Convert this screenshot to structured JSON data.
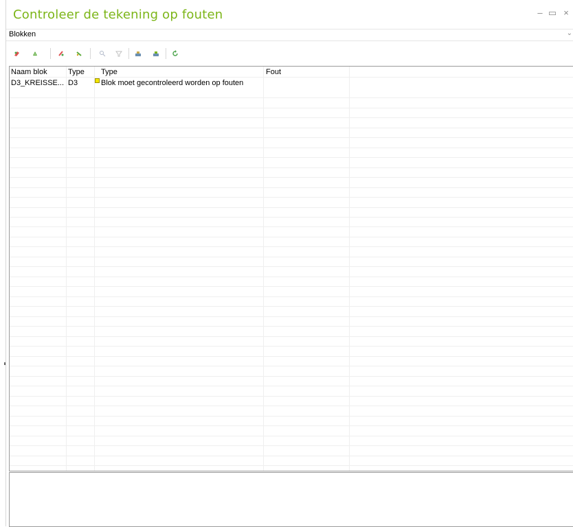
{
  "window": {
    "title": "Controleer de tekening op fouten",
    "accent_color": "#7cb518",
    "controls": {
      "minimize": "–",
      "maximize": "▭",
      "close": "×"
    }
  },
  "dropdown": {
    "selected": "Blokken",
    "chevron": "⌄"
  },
  "toolbar": {
    "buttons": [
      {
        "name": "erase-red-icon"
      },
      {
        "name": "erase-green-icon"
      },
      {
        "name": "select-red-icon"
      },
      {
        "name": "select-green-icon"
      },
      {
        "name": "zoom-icon"
      },
      {
        "name": "filter-icon"
      },
      {
        "name": "print-icon"
      },
      {
        "name": "print-preview-icon"
      },
      {
        "name": "refresh-icon"
      }
    ]
  },
  "grid": {
    "columns": [
      "Naam blok",
      "Type",
      "Type",
      "Fout"
    ],
    "rows": [
      {
        "naam": "D3_KREISSE...",
        "type": "D3",
        "omschrijving": "Blok moet gecontroleerd worden op fouten",
        "fout": "",
        "marker_color": "#f2e600"
      }
    ]
  },
  "bottom_panel": {
    "text": ""
  }
}
